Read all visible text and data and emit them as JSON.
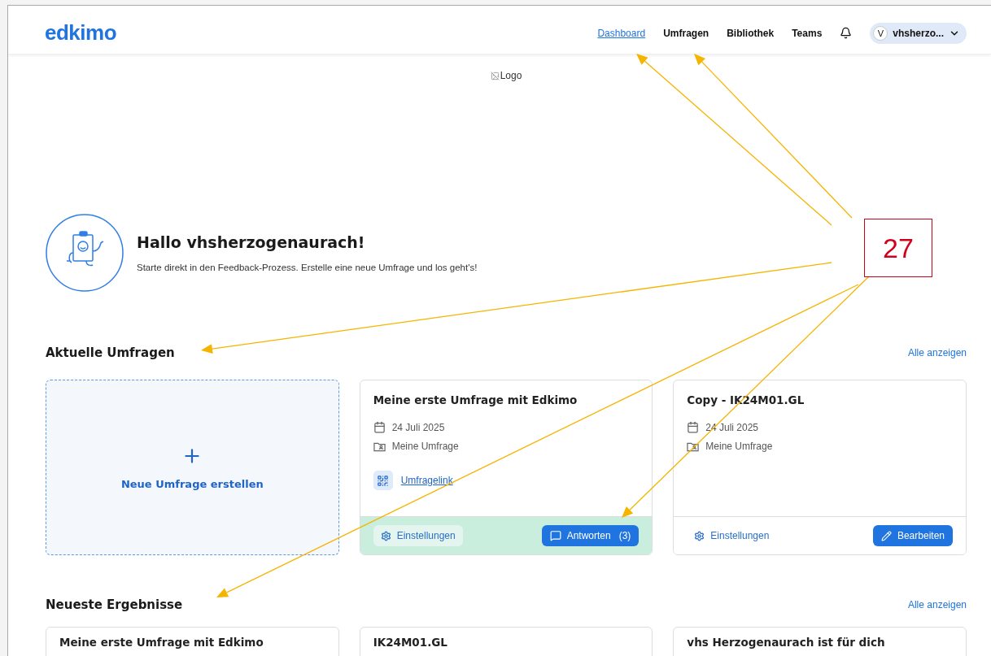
{
  "header": {
    "logo": "edkimo",
    "nav": [
      {
        "label": "Dashboard",
        "selected": true
      },
      {
        "label": "Umfragen",
        "selected": false
      },
      {
        "label": "Bibliothek",
        "selected": false
      },
      {
        "label": "Teams",
        "selected": false
      }
    ],
    "user": {
      "initial": "V",
      "name": "vhsherzo..."
    }
  },
  "broken_image": {
    "alt": "Logo"
  },
  "hero": {
    "title": "Hallo vhsherzogenaurach!",
    "text": "Starte direkt in den Feedback-Prozess. Erstelle eine neue Umfrage und los geht's!"
  },
  "current_surveys": {
    "title": "Aktuelle Umfragen",
    "link": "Alle anzeigen",
    "new_card": {
      "label": "Neue Umfrage erstellen"
    },
    "cards": [
      {
        "title": "Meine erste Umfrage mit Edkimo",
        "date": "24 Juli 2025",
        "folder": "Meine Umfrage",
        "survey_link": "Umfragelink",
        "highlighted": true,
        "settings": "Einstellungen",
        "action": {
          "kind": "responses",
          "label": "Antworten",
          "count": "(3)"
        }
      },
      {
        "title": "Copy - IK24M01.GL",
        "date": "24 Juli 2025",
        "folder": "Meine Umfrage",
        "highlighted": false,
        "settings": "Einstellungen",
        "action": {
          "kind": "edit",
          "label": "Bearbeiten"
        }
      }
    ]
  },
  "latest_results": {
    "title": "Neueste Ergebnisse",
    "link": "Alle anzeigen",
    "cards": [
      {
        "title": "Meine erste Umfrage mit Edkimo"
      },
      {
        "title": "IK24M01.GL"
      },
      {
        "title": "vhs Herzogenaurach ist für dich"
      }
    ]
  },
  "annotation": {
    "label": "27"
  }
}
